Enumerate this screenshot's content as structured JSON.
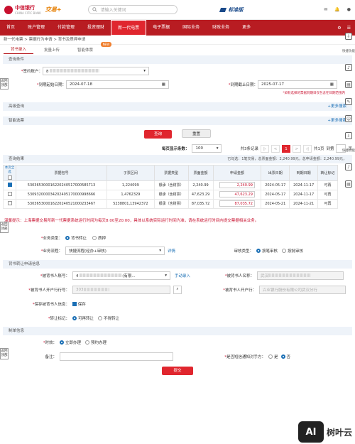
{
  "header": {
    "bank": "中信银行",
    "bank_sub": "CHINA CITIC BANK",
    "brand2": "交易+",
    "search_placeholder": "请输入关键词",
    "version": "标准版"
  },
  "nav": [
    "首页",
    "账户管理",
    "付款管理",
    "投资理财",
    "新一代电票",
    "电子票据",
    "国际业务",
    "财政业务",
    "更多"
  ],
  "breadcrumb": "新一代电票 > 票据行为申请 > 背书及质押申请",
  "tabs": [
    {
      "label": "背书录入"
    },
    {
      "label": "批量上传"
    },
    {
      "label": "智能体票"
    }
  ],
  "new_badge": "NEW",
  "query": {
    "section": "查询条件",
    "account_label": "签约账户：",
    "account_value": "8",
    "start_label": "到期起始日期：",
    "start_value": "2024-07-18",
    "end_label": "到期截止日期：",
    "end_value": "2025-07-17",
    "note": "*如有选择的票据到期日仅包含在日期范围内",
    "advanced": "高级查询",
    "more": "+更多搜索",
    "smart": "智能选票",
    "more2": "+更多搜索",
    "query_btn": "查询",
    "reset_btn": "重置"
  },
  "pager": {
    "per_page_label": "每页显示条数：",
    "per_page": "100",
    "total": "共3条记录",
    "prev": "<",
    "current": "1",
    "next": ">",
    "pages": "共1页",
    "goto": "到第",
    "page": "页"
  },
  "results": {
    "section": "查询结果",
    "summary": "已勾选：1笔交易，总票面金额：2,240.99元，总申请金额：2,240.99元，",
    "select_all": "本页全选",
    "headers": [
      "",
      "票据包号",
      "子票区间",
      "票据类型",
      "票面金额",
      "申请金额",
      "出票日期",
      "到期日期",
      "转让标记"
    ],
    "rows": [
      {
        "checked": true,
        "no": "530365300016220240517000585713",
        "range": "1,224099",
        "type": "银承（含财票）",
        "amount": "2,240.99",
        "apply": "2,240.99",
        "issue": "2024-05-17",
        "due": "2024-11-17",
        "mark": "可再"
      },
      {
        "checked": false,
        "no": "530932000034202405170000998666",
        "range": "1,4762329",
        "type": "银承（含财票）",
        "amount": "47,623.29",
        "apply": "47,623.29",
        "issue": "2024-05-17",
        "due": "2024-11-17",
        "mark": "可再"
      },
      {
        "checked": false,
        "no": "530365300016220240521000233467",
        "range": "5238801,13942372",
        "type": "银承（含财票）",
        "amount": "87,035.72",
        "apply": "87,035.72",
        "issue": "2024-05-21",
        "due": "2024-11-21",
        "mark": "可再"
      }
    ]
  },
  "warning": "温馨提示：上海票据交易所新一代票据系统运行时间为每天8:00至20:00，具体以系统实际运行时间为准，请在系统运行时间内提交票据相关业务。",
  "biz": {
    "type_label": "业务类型：",
    "type_a": "背书转让",
    "type_b": "质押",
    "flow_label": "业务流程：",
    "flow_value": "快捷流程(经办+审核)",
    "flow_detail": "详情",
    "audit_label": "审核类型：",
    "audit_a": "按笔审核",
    "audit_b": "按批审核"
  },
  "endorse": {
    "section": "背书转让申请信息",
    "acct_label": "被背书人账号：",
    "acct_prefix": "4",
    "acct_hint": "(有限...",
    "manual": "手动录入",
    "name_label": "被背书人名称：",
    "name_value": "武汉",
    "bank_no_label": "被背书人开户行行号：",
    "bank_no_value": "303",
    "bank_label": "被背书人开户行：",
    "bank_value": "兴业银行股份有限公司武汉分行",
    "save_label": "保存被背书人信息：",
    "save_value": "保存",
    "mark_label": "转让标记：",
    "mark_a": "可再转让",
    "mark_b": "不得转让"
  },
  "schedule": {
    "section": "制单信息",
    "time_label": "时效：",
    "time_a": "立即办理",
    "time_b": "预约办理",
    "remark_label": "备注：",
    "sms_label": "是否短信通知对手方：",
    "sms_a": "是",
    "sms_b": "否",
    "submit": "提交"
  },
  "side": {
    "back1": "返回顶部",
    "back2": "返回顶部",
    "back3": "返回顶部"
  },
  "rail": {
    "quick": "快捷功能",
    "quick2": "快捷功能"
  },
  "watermark": "树叶云"
}
